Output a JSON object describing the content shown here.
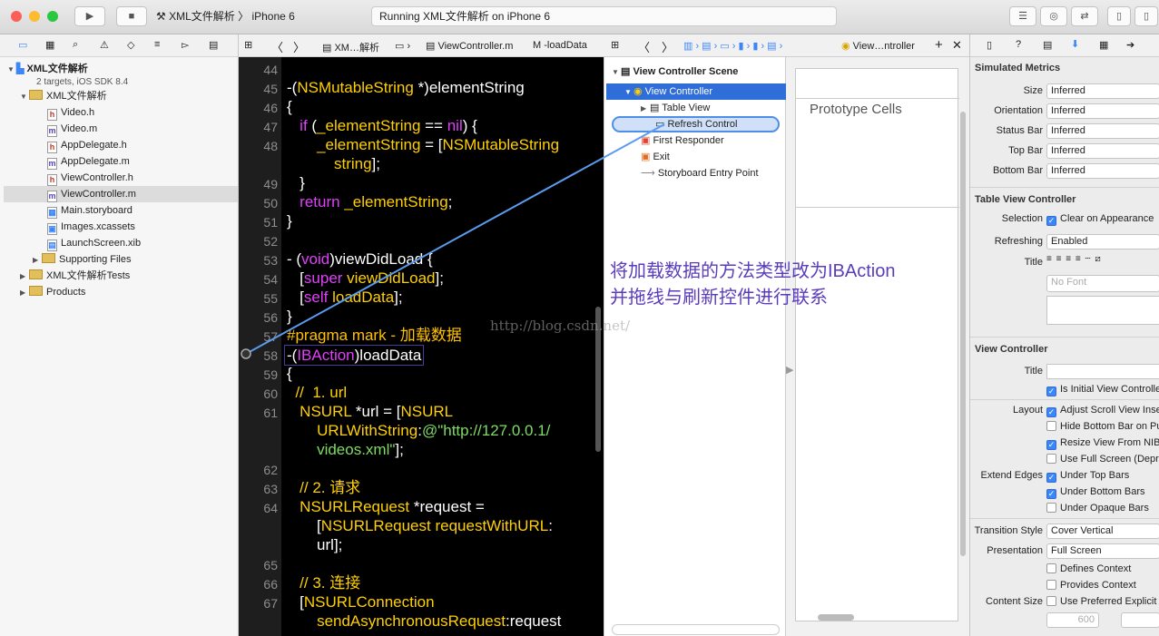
{
  "toolbar": {
    "scheme": "XML文件解析",
    "device": "iPhone 6",
    "status": "Running XML文件解析 on iPhone 6"
  },
  "navigator": {
    "project": "XML文件解析",
    "project_sub": "2 targets, iOS SDK 8.4",
    "group": "XML文件解析",
    "files": [
      {
        "name": "Video.h",
        "kind": "h"
      },
      {
        "name": "Video.m",
        "kind": "m"
      },
      {
        "name": "AppDelegate.h",
        "kind": "h"
      },
      {
        "name": "AppDelegate.m",
        "kind": "m"
      },
      {
        "name": "ViewController.h",
        "kind": "h"
      },
      {
        "name": "ViewController.m",
        "kind": "m"
      },
      {
        "name": "Main.storyboard",
        "kind": "sb"
      },
      {
        "name": "Images.xcassets",
        "kind": "xc"
      },
      {
        "name": "LaunchScreen.xib",
        "kind": "xib"
      }
    ],
    "supporting": "Supporting Files",
    "tests": "XML文件解析Tests",
    "products": "Products"
  },
  "jumpbar": {
    "crumb1": "XM…解析",
    "crumb2": "ViewController.m",
    "crumb3": "-loadData",
    "crumb4": "View…ntroller"
  },
  "outline": {
    "scene": "View Controller Scene",
    "vc": "View Controller",
    "table": "Table View",
    "refresh": "Refresh Control",
    "responder": "First Responder",
    "exit": "Exit",
    "entry": "Storyboard Entry Point"
  },
  "canvas": {
    "prototype": "Prototype Cells"
  },
  "annotation": {
    "line1": "将加载数据的方法类型改为IBAction",
    "line2": "并拖线与刷新控件进行联系",
    "watermark": "http://blog.csdn.net/"
  },
  "inspector": {
    "sim_title": "Simulated Metrics",
    "sim": [
      {
        "label": "Size",
        "value": "Inferred"
      },
      {
        "label": "Orientation",
        "value": "Inferred"
      },
      {
        "label": "Status Bar",
        "value": "Inferred"
      },
      {
        "label": "Top Bar",
        "value": "Inferred"
      },
      {
        "label": "Bottom Bar",
        "value": "Inferred"
      }
    ],
    "tvc_title": "Table View Controller",
    "selection_label": "Selection",
    "selection_value": "Clear on Appearance",
    "refreshing_label": "Refreshing",
    "refreshing_value": "Enabled",
    "title_label": "Title",
    "font_placeholder": "No Font",
    "vc_title": "View Controller",
    "vc_title_label": "Title",
    "initial": "Is Initial View Controller",
    "layout_label": "Layout",
    "layout": [
      {
        "text": "Adjust Scroll View Insets",
        "on": true
      },
      {
        "text": "Hide Bottom Bar on Push",
        "on": false
      },
      {
        "text": "Resize View From NIB",
        "on": true
      },
      {
        "text": "Use Full Screen (Deprecated)",
        "on": false
      }
    ],
    "edges_label": "Extend Edges",
    "edges": [
      {
        "text": "Under Top Bars",
        "on": true
      },
      {
        "text": "Under Bottom Bars",
        "on": true
      },
      {
        "text": "Under Opaque Bars",
        "on": false
      }
    ],
    "transition_label": "Transition Style",
    "transition_value": "Cover Vertical",
    "presentation_label": "Presentation",
    "presentation_value": "Full Screen",
    "defines": "Defines Context",
    "provides": "Provides Context",
    "content_label": "Content Size",
    "content_value": "Use Preferred Explicit Size",
    "w": "600"
  },
  "colors": {
    "accent": "#3d86f7",
    "editor_bg": "#000000"
  }
}
